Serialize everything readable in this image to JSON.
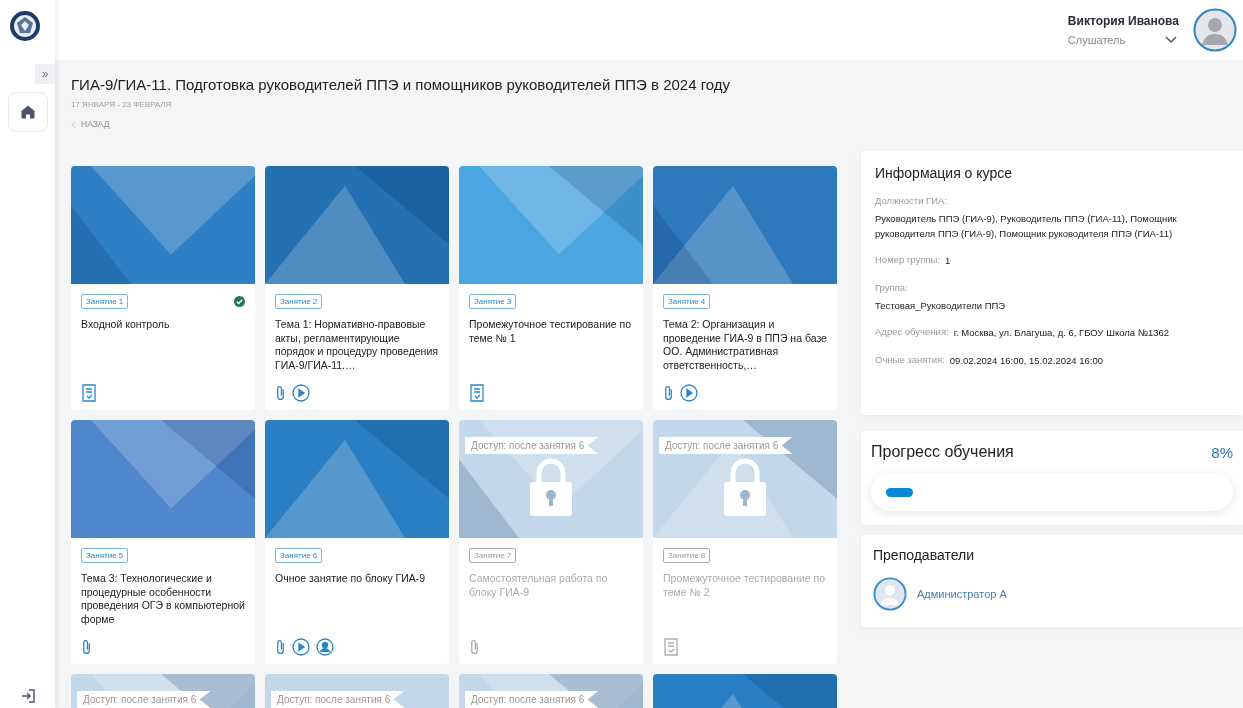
{
  "header": {
    "user_name": "Виктория Иванова",
    "role": "Слушатель"
  },
  "sidebar": {
    "toggle": "»"
  },
  "course": {
    "title": "ГИА-9/ГИА-11. Подготовка руководителей ППЭ и помощников руководителей ППЭ в 2024 году",
    "dates": "17 ЯНВАРЯ - 23 ФЕВРАЛЯ",
    "back": "НАЗАД"
  },
  "lessons": [
    {
      "tag": "Занятие 1",
      "title": "Входной контроль",
      "locked": false,
      "completed": true,
      "icons": [
        {
          "kind": "test"
        }
      ]
    },
    {
      "tag": "Занятие 2",
      "title": "Тема 1: Нормативно-правовые акты, регламентирующие порядок и процедуру проведения ГИА-9/ГИА-11.…",
      "locked": false,
      "completed": false,
      "icons": [
        {
          "kind": "attach"
        },
        {
          "kind": "play"
        }
      ]
    },
    {
      "tag": "Занятие 3",
      "title": "Промежуточное тестирование по теме № 1",
      "locked": false,
      "completed": false,
      "icons": [
        {
          "kind": "test"
        }
      ]
    },
    {
      "tag": "Занятие 4",
      "title": "Тема 2: Организация и проведение ГИА-9 в ППЭ на базе ОО. Административная ответственность,…",
      "locked": false,
      "completed": false,
      "icons": [
        {
          "kind": "attach"
        },
        {
          "kind": "play"
        }
      ]
    },
    {
      "tag": "Занятие 5",
      "title": "Тема 3: Технологические и процедурные особенности проведения ОГЭ в компьютерной форме",
      "locked": false,
      "completed": false,
      "icons": [
        {
          "kind": "attach"
        }
      ]
    },
    {
      "tag": "Занятие 6",
      "title": "Очное занятие по блоку ГИА-9",
      "locked": false,
      "completed": false,
      "icons": [
        {
          "kind": "attach"
        },
        {
          "kind": "play"
        },
        {
          "kind": "person"
        }
      ]
    },
    {
      "tag": "Занятие 7",
      "title": "Самостоятельная работа по блоку ГИА-9",
      "access": "Доступ: после занятия 6",
      "locked": true,
      "completed": false,
      "icons": [
        {
          "kind": "attach"
        }
      ]
    },
    {
      "tag": "Занятие 8",
      "title": "Промежуточное тестирование по теме № 2",
      "access": "Доступ: после занятия 6",
      "locked": true,
      "completed": false,
      "icons": [
        {
          "kind": "test"
        }
      ]
    },
    {
      "access": "Доступ: после занятия 6",
      "locked": true
    },
    {
      "access": "Доступ: после занятия 6",
      "locked": true
    },
    {
      "access": "Доступ: после занятия 6",
      "locked": true
    },
    {
      "locked": false
    }
  ],
  "info": {
    "title": "Информация о курсе",
    "fields": [
      {
        "kind": "block",
        "label": "Должности ГИА:",
        "value": "Руководитель ППЭ (ГИА-9), Руководитель ППЭ (ГИА-11), Помощник руководителя ППЭ (ГИА-9), Помощник руководителя ППЭ (ГИА-11)"
      },
      {
        "kind": "inline",
        "label": "Номер группы:",
        "value": "1"
      },
      {
        "kind": "block",
        "label": "Группа:",
        "value": "Тестовая_Руководители ППЭ"
      },
      {
        "kind": "inline",
        "label": "Адрес обучения:",
        "value": "г. Москва, ул. Благуша, д. 6, ГБОУ Школа №1362"
      },
      {
        "kind": "inline",
        "label": "Очные занятия:",
        "value": "09.02.2024 16:00, 15.02.2024 16:00"
      }
    ]
  },
  "progress": {
    "title": "Прогресс обучения",
    "percent": "8%",
    "level": 0.08
  },
  "teachers": {
    "title": "Преподаватели",
    "items": [
      {
        "name": "Администратор А"
      }
    ]
  }
}
